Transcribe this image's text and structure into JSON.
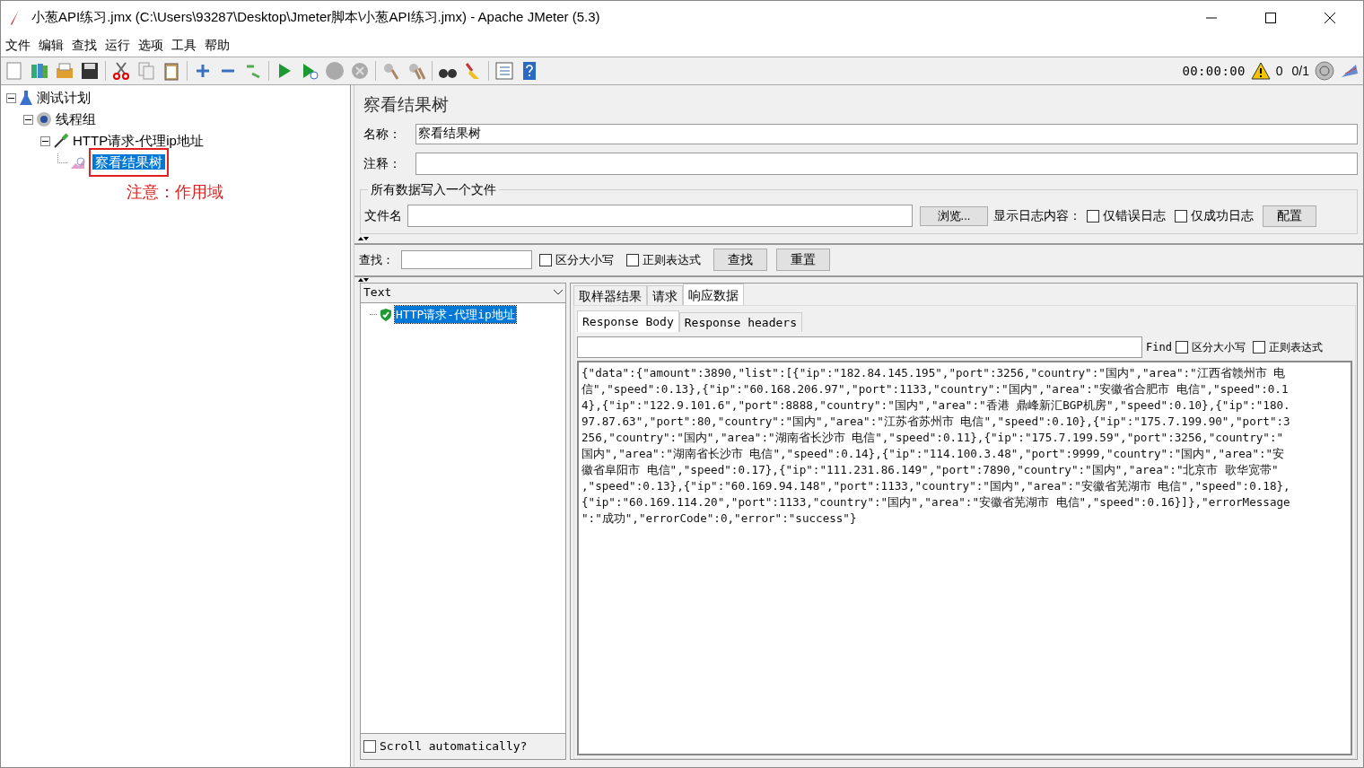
{
  "window": {
    "title": "小葱API练习.jmx (C:\\Users\\93287\\Desktop\\Jmeter脚本\\小葱API练习.jmx) - Apache JMeter (5.3)"
  },
  "menu": [
    "文件",
    "编辑",
    "查找",
    "运行",
    "选项",
    "工具",
    "帮助"
  ],
  "toolbar_status": {
    "timer": "00:00:00",
    "errors": "0",
    "threads": "0/1"
  },
  "tree": [
    {
      "label": "测试计划",
      "kind": "plan",
      "expanded": true,
      "selected": false,
      "children": [
        {
          "label": "线程组",
          "kind": "group",
          "expanded": true,
          "selected": false,
          "children": [
            {
              "label": "HTTP请求-代理ip地址",
              "kind": "sampler",
              "expanded": true,
              "selected": false,
              "children": [
                {
                  "label": "察看结果树",
                  "kind": "listener",
                  "selected": true
                }
              ]
            }
          ]
        }
      ]
    }
  ],
  "annotation": "注意：作用域",
  "panel": {
    "title": "察看结果树",
    "name_label": "名称：",
    "name_value": "察看结果树",
    "comment_label": "注释：",
    "file_group": "所有数据写入一个文件",
    "file_label": "文件名",
    "browse_button": "浏览...",
    "log_label": "显示日志内容：",
    "log_options": [
      {
        "label": "仅错误日志",
        "checked": false
      },
      {
        "label": "仅成功日志",
        "checked": false
      }
    ],
    "config_button": "配置",
    "search_label": "查找：",
    "search_options": [
      {
        "label": "区分大小写",
        "checked": false
      },
      {
        "label": "正则表达式",
        "checked": false
      }
    ],
    "find_button": "查找",
    "reset_button": "重置"
  },
  "results": {
    "renderer": "Text",
    "items": [
      {
        "label": "HTTP请求-代理ip地址",
        "selected": true
      }
    ],
    "scroll_auto": {
      "label": "Scroll automatically?",
      "checked": false
    },
    "tabs": [
      {
        "label": "取样器结果",
        "selected": false
      },
      {
        "label": "请求",
        "selected": false
      },
      {
        "label": "响应数据",
        "selected": true
      }
    ],
    "subtabs": [
      {
        "label": "Response Body",
        "selected": true
      },
      {
        "label": "Response headers",
        "selected": false
      }
    ],
    "find_label": "Find",
    "find_options": [
      {
        "label": "区分大小写",
        "checked": false
      },
      {
        "label": "正则表达式",
        "checked": false
      }
    ],
    "body_lines": [
      "{\"data\":{\"amount\":3890,\"list\":[{\"ip\":\"182.84.145.195\",\"port\":3256,\"country\":\"国内\",\"area\":\"江西省赣州市 电",
      "信\",\"speed\":0.13},{\"ip\":\"60.168.206.97\",\"port\":1133,\"country\":\"国内\",\"area\":\"安徽省合肥市 电信\",\"speed\":0.1",
      "4},{\"ip\":\"122.9.101.6\",\"port\":8888,\"country\":\"国内\",\"area\":\"香港 鼎峰新汇BGP机房\",\"speed\":0.10},{\"ip\":\"180.",
      "97.87.63\",\"port\":80,\"country\":\"国内\",\"area\":\"江苏省苏州市 电信\",\"speed\":0.10},{\"ip\":\"175.7.199.90\",\"port\":3",
      "256,\"country\":\"国内\",\"area\":\"湖南省长沙市 电信\",\"speed\":0.11},{\"ip\":\"175.7.199.59\",\"port\":3256,\"country\":\"",
      "国内\",\"area\":\"湖南省长沙市 电信\",\"speed\":0.14},{\"ip\":\"114.100.3.48\",\"port\":9999,\"country\":\"国内\",\"area\":\"安",
      "徽省阜阳市 电信\",\"speed\":0.17},{\"ip\":\"111.231.86.149\",\"port\":7890,\"country\":\"国内\",\"area\":\"北京市 歌华宽带\"",
      ",\"speed\":0.13},{\"ip\":\"60.169.94.148\",\"port\":1133,\"country\":\"国内\",\"area\":\"安徽省芜湖市 电信\",\"speed\":0.18},",
      "{\"ip\":\"60.169.114.20\",\"port\":1133,\"country\":\"国内\",\"area\":\"安徽省芜湖市 电信\",\"speed\":0.16}]},\"errorMessage",
      "\":\"成功\",\"errorCode\":0,\"error\":\"success\"}"
    ]
  }
}
